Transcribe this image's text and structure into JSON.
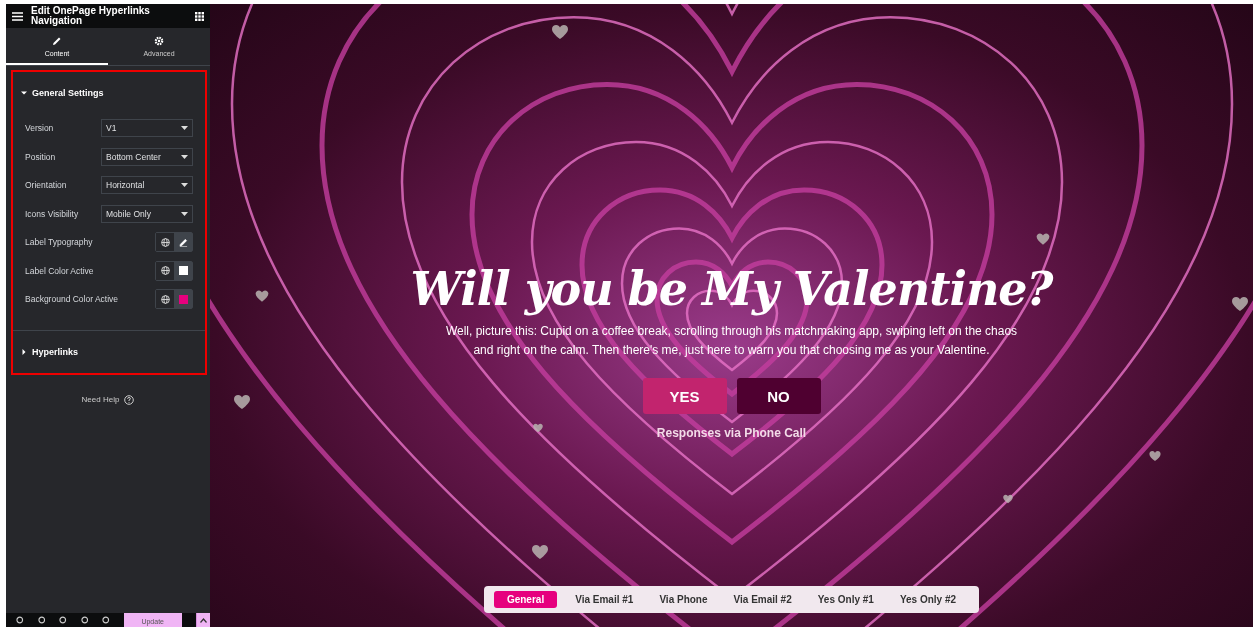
{
  "panel": {
    "title": "Edit OnePage Hyperlinks Navigation",
    "tabs": [
      {
        "label": "Content",
        "selected": true
      },
      {
        "label": "Advanced",
        "selected": false
      }
    ],
    "sections": [
      {
        "title": "General Settings",
        "expanded": true,
        "controls": [
          {
            "kind": "select",
            "label": "Version",
            "value": "V1"
          },
          {
            "kind": "select",
            "label": "Position",
            "value": "Bottom Center"
          },
          {
            "kind": "select",
            "label": "Orientation",
            "value": "Horizontal"
          },
          {
            "kind": "select",
            "label": "Icons Visibility",
            "value": "Mobile Only"
          },
          {
            "kind": "typography",
            "label": "Label Typography"
          },
          {
            "kind": "color",
            "label": "Label Color Active",
            "color": "#ffffff"
          },
          {
            "kind": "color",
            "label": "Background Color Active",
            "color": "#e6007e"
          }
        ]
      },
      {
        "title": "Hyperlinks",
        "expanded": false
      }
    ],
    "help": "Need Help",
    "footer": {
      "update_button": "Update"
    }
  },
  "page": {
    "title": "Will you be My Valentine?",
    "text": "Well, picture this: Cupid on a coffee break, scrolling through his matchmaking app, swiping left on the chaos and right on the calm. Then there's me, just here to warn you that choosing me as your Valentine.",
    "buttons": [
      {
        "label": "YES",
        "kind": "primary"
      },
      {
        "label": "NO",
        "kind": "secondary"
      }
    ],
    "caption": "Responses via Phone Call",
    "nav": [
      {
        "label": "General",
        "selected": true
      },
      {
        "label": "Via Email #1",
        "selected": false
      },
      {
        "label": "Via Phone",
        "selected": false
      },
      {
        "label": "Via Email #2",
        "selected": false
      },
      {
        "label": "Yes Only #1",
        "selected": false
      },
      {
        "label": "Yes Only #2",
        "selected": false
      }
    ]
  }
}
